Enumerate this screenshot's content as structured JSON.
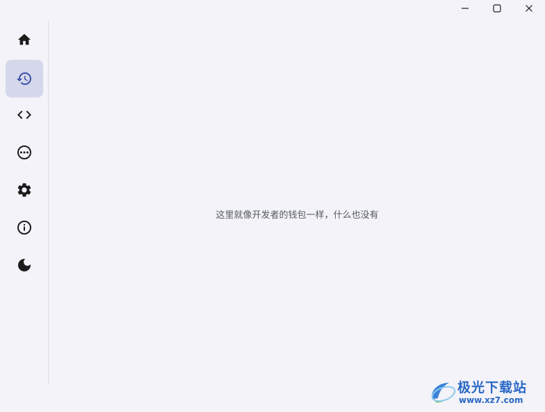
{
  "window": {
    "controls": {
      "minimize_icon": "minimize-icon",
      "maximize_icon": "maximize-icon",
      "close_icon": "close-icon"
    }
  },
  "sidebar": {
    "items": [
      {
        "icon": "home-icon",
        "active": false
      },
      {
        "icon": "history-icon",
        "active": true
      },
      {
        "icon": "code-icon",
        "active": false
      },
      {
        "icon": "more-icon",
        "active": false
      },
      {
        "icon": "settings-icon",
        "active": false
      },
      {
        "icon": "info-icon",
        "active": false
      },
      {
        "icon": "dark-mode-icon",
        "active": false
      }
    ]
  },
  "main": {
    "empty_message": "这里就像开发者的钱包一样，什么也没有"
  },
  "watermark": {
    "title": "极光下载站",
    "url": "www.xz7.com"
  },
  "colors": {
    "background": "#f3f3f9",
    "active_nav_bg": "#d5d8ea",
    "active_icon": "#3d4fa8",
    "icon": "#1c1c1c",
    "watermark": "#2a68c4"
  }
}
